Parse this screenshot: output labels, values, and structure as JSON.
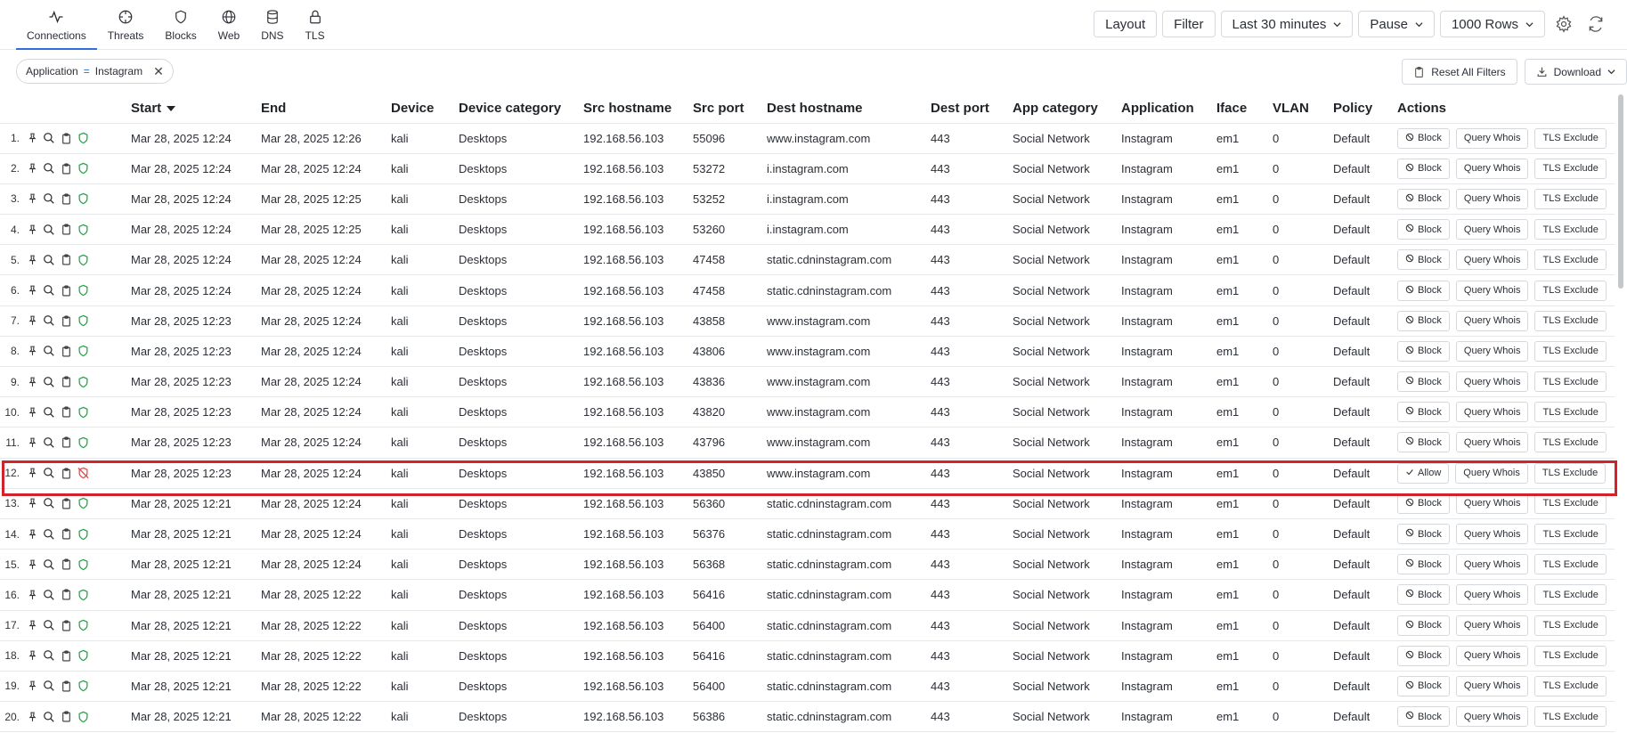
{
  "nav": {
    "tabs": [
      {
        "label": "Connections",
        "icon": "activity-icon"
      },
      {
        "label": "Threats",
        "icon": "crosshair-icon"
      },
      {
        "label": "Blocks",
        "icon": "shield-icon"
      },
      {
        "label": "Web",
        "icon": "globe-icon"
      },
      {
        "label": "DNS",
        "icon": "database-icon"
      },
      {
        "label": "TLS",
        "icon": "lock-icon"
      }
    ],
    "active": "Connections"
  },
  "toolbar": {
    "layout_label": "Layout",
    "filter_label": "Filter",
    "timerange_label": "Last 30 minutes",
    "pause_label": "Pause",
    "rows_label": "1000 Rows"
  },
  "filter": {
    "field": "Application",
    "op": "=",
    "value": "Instagram",
    "reset_label": "Reset All Filters",
    "download_label": "Download"
  },
  "table": {
    "columns": [
      "Start",
      "End",
      "Device",
      "Device category",
      "Src hostname",
      "Src port",
      "Dest hostname",
      "Dest port",
      "App category",
      "Application",
      "Iface",
      "VLAN",
      "Policy",
      "Actions"
    ],
    "action_labels": {
      "block": "Block",
      "allow": "Allow",
      "whois": "Query Whois",
      "tls": "TLS Exclude"
    },
    "rows": [
      {
        "n": "1.",
        "start": "Mar 28, 2025 12:24",
        "end": "Mar 28, 2025 12:26",
        "device": "kali",
        "cat": "Desktops",
        "src": "192.168.56.103",
        "sport": "55096",
        "dest": "www.instagram.com",
        "dport": "443",
        "appcat": "Social Network",
        "app": "Instagram",
        "iface": "em1",
        "vlan": "0",
        "policy": "Default",
        "blocked": false
      },
      {
        "n": "2.",
        "start": "Mar 28, 2025 12:24",
        "end": "Mar 28, 2025 12:24",
        "device": "kali",
        "cat": "Desktops",
        "src": "192.168.56.103",
        "sport": "53272",
        "dest": "i.instagram.com",
        "dport": "443",
        "appcat": "Social Network",
        "app": "Instagram",
        "iface": "em1",
        "vlan": "0",
        "policy": "Default",
        "blocked": false
      },
      {
        "n": "3.",
        "start": "Mar 28, 2025 12:24",
        "end": "Mar 28, 2025 12:25",
        "device": "kali",
        "cat": "Desktops",
        "src": "192.168.56.103",
        "sport": "53252",
        "dest": "i.instagram.com",
        "dport": "443",
        "appcat": "Social Network",
        "app": "Instagram",
        "iface": "em1",
        "vlan": "0",
        "policy": "Default",
        "blocked": false
      },
      {
        "n": "4.",
        "start": "Mar 28, 2025 12:24",
        "end": "Mar 28, 2025 12:25",
        "device": "kali",
        "cat": "Desktops",
        "src": "192.168.56.103",
        "sport": "53260",
        "dest": "i.instagram.com",
        "dport": "443",
        "appcat": "Social Network",
        "app": "Instagram",
        "iface": "em1",
        "vlan": "0",
        "policy": "Default",
        "blocked": false
      },
      {
        "n": "5.",
        "start": "Mar 28, 2025 12:24",
        "end": "Mar 28, 2025 12:24",
        "device": "kali",
        "cat": "Desktops",
        "src": "192.168.56.103",
        "sport": "47458",
        "dest": "static.cdninstagram.com",
        "dport": "443",
        "appcat": "Social Network",
        "app": "Instagram",
        "iface": "em1",
        "vlan": "0",
        "policy": "Default",
        "blocked": false
      },
      {
        "n": "6.",
        "start": "Mar 28, 2025 12:24",
        "end": "Mar 28, 2025 12:24",
        "device": "kali",
        "cat": "Desktops",
        "src": "192.168.56.103",
        "sport": "47458",
        "dest": "static.cdninstagram.com",
        "dport": "443",
        "appcat": "Social Network",
        "app": "Instagram",
        "iface": "em1",
        "vlan": "0",
        "policy": "Default",
        "blocked": false
      },
      {
        "n": "7.",
        "start": "Mar 28, 2025 12:23",
        "end": "Mar 28, 2025 12:24",
        "device": "kali",
        "cat": "Desktops",
        "src": "192.168.56.103",
        "sport": "43858",
        "dest": "www.instagram.com",
        "dport": "443",
        "appcat": "Social Network",
        "app": "Instagram",
        "iface": "em1",
        "vlan": "0",
        "policy": "Default",
        "blocked": false
      },
      {
        "n": "8.",
        "start": "Mar 28, 2025 12:23",
        "end": "Mar 28, 2025 12:24",
        "device": "kali",
        "cat": "Desktops",
        "src": "192.168.56.103",
        "sport": "43806",
        "dest": "www.instagram.com",
        "dport": "443",
        "appcat": "Social Network",
        "app": "Instagram",
        "iface": "em1",
        "vlan": "0",
        "policy": "Default",
        "blocked": false
      },
      {
        "n": "9.",
        "start": "Mar 28, 2025 12:23",
        "end": "Mar 28, 2025 12:24",
        "device": "kali",
        "cat": "Desktops",
        "src": "192.168.56.103",
        "sport": "43836",
        "dest": "www.instagram.com",
        "dport": "443",
        "appcat": "Social Network",
        "app": "Instagram",
        "iface": "em1",
        "vlan": "0",
        "policy": "Default",
        "blocked": false
      },
      {
        "n": "10.",
        "start": "Mar 28, 2025 12:23",
        "end": "Mar 28, 2025 12:24",
        "device": "kali",
        "cat": "Desktops",
        "src": "192.168.56.103",
        "sport": "43820",
        "dest": "www.instagram.com",
        "dport": "443",
        "appcat": "Social Network",
        "app": "Instagram",
        "iface": "em1",
        "vlan": "0",
        "policy": "Default",
        "blocked": false
      },
      {
        "n": "11.",
        "start": "Mar 28, 2025 12:23",
        "end": "Mar 28, 2025 12:24",
        "device": "kali",
        "cat": "Desktops",
        "src": "192.168.56.103",
        "sport": "43796",
        "dest": "www.instagram.com",
        "dport": "443",
        "appcat": "Social Network",
        "app": "Instagram",
        "iface": "em1",
        "vlan": "0",
        "policy": "Default",
        "blocked": false
      },
      {
        "n": "12.",
        "start": "Mar 28, 2025 12:23",
        "end": "Mar 28, 2025 12:24",
        "device": "kali",
        "cat": "Desktops",
        "src": "192.168.56.103",
        "sport": "43850",
        "dest": "www.instagram.com",
        "dport": "443",
        "appcat": "Social Network",
        "app": "Instagram",
        "iface": "em1",
        "vlan": "0",
        "policy": "Default",
        "blocked": true
      },
      {
        "n": "13.",
        "start": "Mar 28, 2025 12:21",
        "end": "Mar 28, 2025 12:24",
        "device": "kali",
        "cat": "Desktops",
        "src": "192.168.56.103",
        "sport": "56360",
        "dest": "static.cdninstagram.com",
        "dport": "443",
        "appcat": "Social Network",
        "app": "Instagram",
        "iface": "em1",
        "vlan": "0",
        "policy": "Default",
        "blocked": false
      },
      {
        "n": "14.",
        "start": "Mar 28, 2025 12:21",
        "end": "Mar 28, 2025 12:24",
        "device": "kali",
        "cat": "Desktops",
        "src": "192.168.56.103",
        "sport": "56376",
        "dest": "static.cdninstagram.com",
        "dport": "443",
        "appcat": "Social Network",
        "app": "Instagram",
        "iface": "em1",
        "vlan": "0",
        "policy": "Default",
        "blocked": false
      },
      {
        "n": "15.",
        "start": "Mar 28, 2025 12:21",
        "end": "Mar 28, 2025 12:24",
        "device": "kali",
        "cat": "Desktops",
        "src": "192.168.56.103",
        "sport": "56368",
        "dest": "static.cdninstagram.com",
        "dport": "443",
        "appcat": "Social Network",
        "app": "Instagram",
        "iface": "em1",
        "vlan": "0",
        "policy": "Default",
        "blocked": false
      },
      {
        "n": "16.",
        "start": "Mar 28, 2025 12:21",
        "end": "Mar 28, 2025 12:22",
        "device": "kali",
        "cat": "Desktops",
        "src": "192.168.56.103",
        "sport": "56416",
        "dest": "static.cdninstagram.com",
        "dport": "443",
        "appcat": "Social Network",
        "app": "Instagram",
        "iface": "em1",
        "vlan": "0",
        "policy": "Default",
        "blocked": false
      },
      {
        "n": "17.",
        "start": "Mar 28, 2025 12:21",
        "end": "Mar 28, 2025 12:22",
        "device": "kali",
        "cat": "Desktops",
        "src": "192.168.56.103",
        "sport": "56400",
        "dest": "static.cdninstagram.com",
        "dport": "443",
        "appcat": "Social Network",
        "app": "Instagram",
        "iface": "em1",
        "vlan": "0",
        "policy": "Default",
        "blocked": false
      },
      {
        "n": "18.",
        "start": "Mar 28, 2025 12:21",
        "end": "Mar 28, 2025 12:22",
        "device": "kali",
        "cat": "Desktops",
        "src": "192.168.56.103",
        "sport": "56416",
        "dest": "static.cdninstagram.com",
        "dport": "443",
        "appcat": "Social Network",
        "app": "Instagram",
        "iface": "em1",
        "vlan": "0",
        "policy": "Default",
        "blocked": false
      },
      {
        "n": "19.",
        "start": "Mar 28, 2025 12:21",
        "end": "Mar 28, 2025 12:22",
        "device": "kali",
        "cat": "Desktops",
        "src": "192.168.56.103",
        "sport": "56400",
        "dest": "static.cdninstagram.com",
        "dport": "443",
        "appcat": "Social Network",
        "app": "Instagram",
        "iface": "em1",
        "vlan": "0",
        "policy": "Default",
        "blocked": false
      },
      {
        "n": "20.",
        "start": "Mar 28, 2025 12:21",
        "end": "Mar 28, 2025 12:22",
        "device": "kali",
        "cat": "Desktops",
        "src": "192.168.56.103",
        "sport": "56386",
        "dest": "static.cdninstagram.com",
        "dport": "443",
        "appcat": "Social Network",
        "app": "Instagram",
        "iface": "em1",
        "vlan": "0",
        "policy": "Default",
        "blocked": false
      }
    ]
  },
  "colors": {
    "accent": "#2f6fde",
    "allowed": "#22a447",
    "blocked": "#e5484d",
    "highlight": "#d3222a"
  }
}
